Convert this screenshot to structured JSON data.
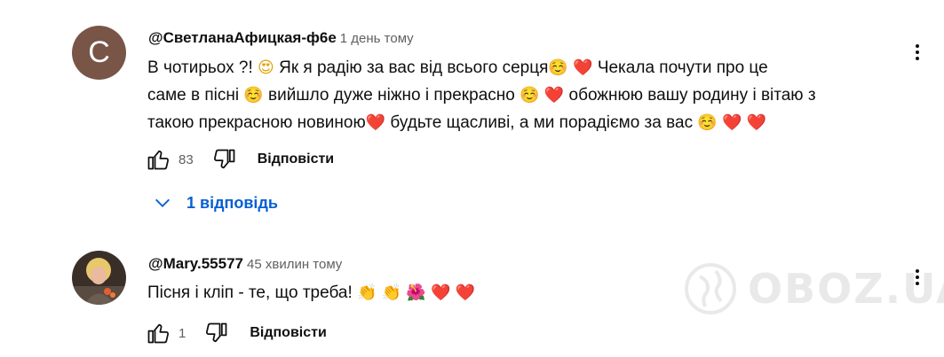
{
  "comments": [
    {
      "avatar_letter": "С",
      "author": "@СветланаАфицкая-ф6е",
      "time": "1 день тому",
      "lines": [
        [
          "В чотирьох ?! ",
          "😍",
          " Як я радію за вас від всього серця",
          "☺️",
          " ",
          "❤️",
          " Чекала почути про це"
        ],
        [
          "саме в пісні ",
          "☺️",
          " вийшло дуже ніжно і прекрасно ",
          "☺️",
          " ",
          "❤️",
          " обожнюю вашу родину і вітаю з"
        ],
        [
          "такою прекрасною новиною",
          "❤️",
          " будьте щасливі, а ми порадіємо за вас ",
          "☺️",
          " ",
          "❤️",
          " ",
          "❤️"
        ]
      ],
      "likes": "83",
      "reply_label": "Відповісти"
    },
    {
      "author": "@Mary.55577",
      "time": "45 хвилин тому",
      "lines": [
        [
          "Пісня і кліп - те, що треба! ",
          "👏",
          " ",
          "👏",
          " ",
          "🌺",
          " ",
          "❤️",
          " ",
          "❤️"
        ]
      ],
      "likes": "1",
      "reply_label": "Відповісти"
    }
  ],
  "replies_toggle": {
    "label": "1 відповідь"
  },
  "watermark": {
    "text": "OBOZ.UA"
  },
  "colors": {
    "accent": "#065fd4",
    "avatar_bg": "#795548",
    "heart": "#e0245e",
    "muted": "#606060"
  },
  "icons": [
    "like-icon",
    "dislike-icon",
    "chevron-down-icon",
    "more-vert-icon",
    "globe-icon"
  ]
}
